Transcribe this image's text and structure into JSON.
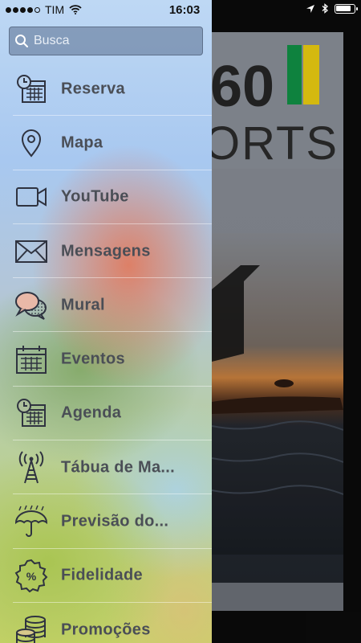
{
  "status_bar": {
    "carrier": "TIM",
    "time": "16:03",
    "signal_bars_filled": 4,
    "signal_bars_total": 5,
    "battery_level": 0.9
  },
  "search": {
    "placeholder": "Busca"
  },
  "menu": {
    "items": [
      {
        "label": "Reserva",
        "icon": "calendar-clock-icon"
      },
      {
        "label": "Mapa",
        "icon": "map-pin-icon"
      },
      {
        "label": "YouTube",
        "icon": "video-camera-icon"
      },
      {
        "label": "Mensagens",
        "icon": "envelope-icon"
      },
      {
        "label": "Mural",
        "icon": "chat-bubbles-icon"
      },
      {
        "label": "Eventos",
        "icon": "calendar-icon"
      },
      {
        "label": "Agenda",
        "icon": "calendar-clock-icon"
      },
      {
        "label": "Tábua de Ma...",
        "icon": "radio-tower-icon"
      },
      {
        "label": "Previsão do...",
        "icon": "umbrella-rain-icon"
      },
      {
        "label": "Fidelidade",
        "icon": "percent-badge-icon"
      },
      {
        "label": "Promoções",
        "icon": "coins-icon"
      }
    ]
  },
  "background": {
    "logo_text_top": "60",
    "logo_text_bottom": "ORTS",
    "accent_colors": [
      "#119447",
      "#f2d312"
    ]
  }
}
